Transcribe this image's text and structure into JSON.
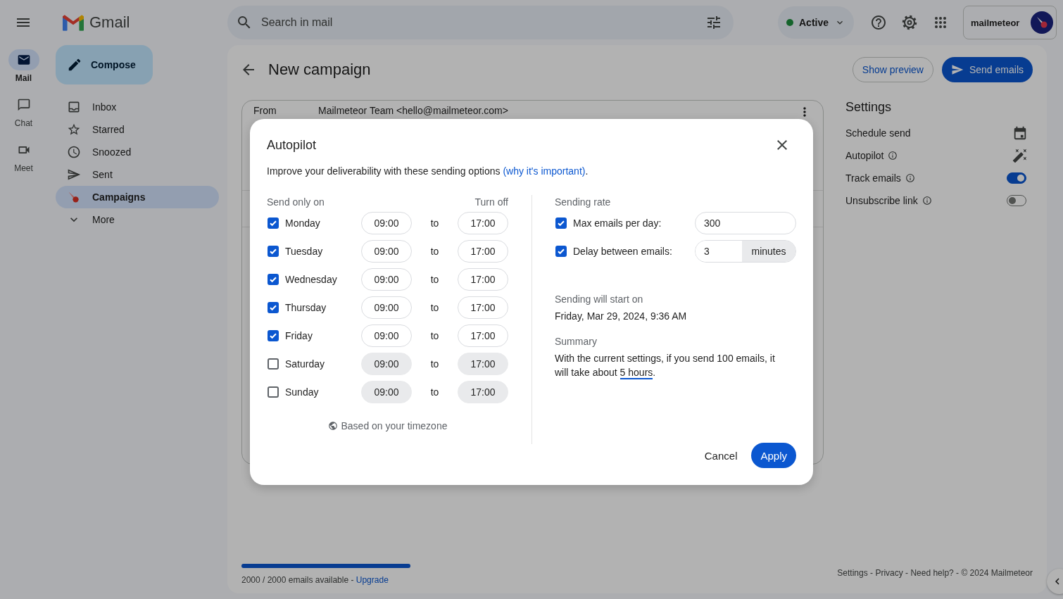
{
  "rail": [
    {
      "label": "Mail",
      "selected": true
    },
    {
      "label": "Chat",
      "selected": false
    },
    {
      "label": "Meet",
      "selected": false
    }
  ],
  "app": {
    "name": "Gmail"
  },
  "compose": "Compose",
  "nav": [
    {
      "label": "Inbox",
      "selected": false
    },
    {
      "label": "Starred",
      "selected": false
    },
    {
      "label": "Snoozed",
      "selected": false
    },
    {
      "label": "Sent",
      "selected": false
    },
    {
      "label": "Campaigns",
      "selected": true
    },
    {
      "label": "More",
      "selected": false
    }
  ],
  "search": {
    "placeholder": "Search in mail"
  },
  "status": {
    "label": "Active"
  },
  "account": {
    "name": "mailmeteor"
  },
  "campaign": {
    "title": "New campaign",
    "buttons": [
      "Show preview",
      "Send emails"
    ]
  },
  "editor": {
    "from_label": "From",
    "from_value": "Mailmeteor Team <hello@mailmeteor.com>"
  },
  "settings": {
    "title": "Settings",
    "items": [
      {
        "label": "Schedule send",
        "kind": "action",
        "info": false
      },
      {
        "label": "Autopilot",
        "kind": "action",
        "info": true
      },
      {
        "label": "Track emails",
        "kind": "toggle",
        "info": true,
        "on": true
      },
      {
        "label": "Unsubscribe link",
        "kind": "toggle",
        "info": true,
        "on": false
      }
    ]
  },
  "quota": {
    "level": 1,
    "text": "2000 / 2000 emails available - ",
    "link": "Upgrade"
  },
  "footer": "Settings - Privacy - Need help? - © 2024 Mailmeteor",
  "dialog": {
    "title": "Autopilot",
    "description": "Improve your deliverability with these sending options ",
    "link": "(why it's important)",
    "after": ".",
    "schedule": {
      "heading": "Send only on",
      "turn_off": "Turn off",
      "days": [
        {
          "day": "Monday",
          "checked": true,
          "from": "09:00",
          "separator": "to",
          "to": "17:00"
        },
        {
          "day": "Tuesday",
          "checked": true,
          "from": "09:00",
          "separator": "to",
          "to": "17:00"
        },
        {
          "day": "Wednesday",
          "checked": true,
          "from": "09:00",
          "separator": "to",
          "to": "17:00"
        },
        {
          "day": "Thursday",
          "checked": true,
          "from": "09:00",
          "separator": "to",
          "to": "17:00"
        },
        {
          "day": "Friday",
          "checked": true,
          "from": "09:00",
          "separator": "to",
          "to": "17:00"
        },
        {
          "day": "Saturday",
          "checked": false,
          "from": "09:00",
          "separator": "to",
          "to": "17:00"
        },
        {
          "day": "Sunday",
          "checked": false,
          "from": "09:00",
          "separator": "to",
          "to": "17:00"
        }
      ],
      "timezone": "Based on your timezone"
    },
    "rate": {
      "heading": "Sending rate",
      "items": [
        {
          "label": "Max emails per day:",
          "checked": true,
          "value": "300"
        },
        {
          "label": "Delay between emails:",
          "checked": true,
          "value": "3",
          "unit": "minutes"
        }
      ]
    },
    "start": {
      "heading": "Sending will start on",
      "value": "Friday, Mar 29, 2024, 9:36 AM"
    },
    "summary": {
      "heading": "Summary",
      "text": "With the current settings, if you send 100 emails, it will take about ",
      "highlight": "5 hours",
      "after": "."
    },
    "buttons": [
      "Cancel",
      "Apply"
    ]
  }
}
